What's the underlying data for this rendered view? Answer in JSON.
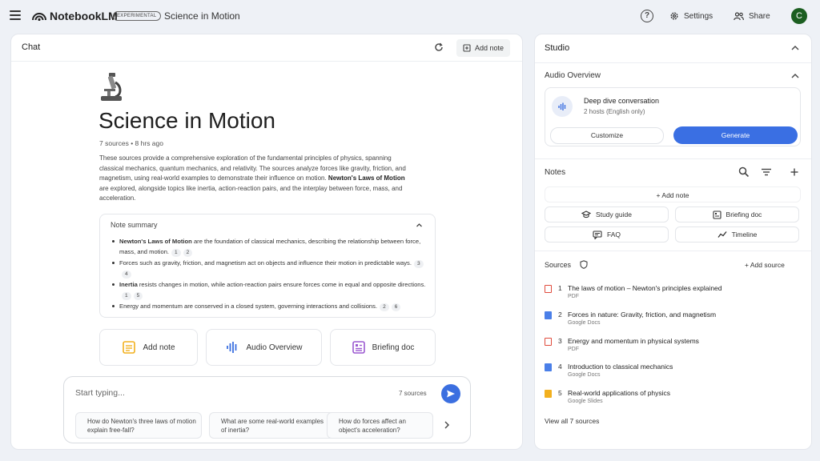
{
  "topbar": {
    "app_name": "NotebookLM",
    "badge": "EXPERIMENTAL",
    "notebook_title": "Science in Motion",
    "help_label": "?",
    "settings_label": "Settings",
    "share_label": "Share",
    "avatar_letter": "C"
  },
  "chat": {
    "title": "Chat",
    "add_note_label": "Add note",
    "heading": "Science in Motion",
    "meta": "7 sources • 8 hrs ago",
    "description_part1": "These sources provide a comprehensive exploration of the fundamental principles of physics, spanning classical mechanics, quantum mechanics, and relativity. The sources analyze forces like gravity, friction, and magnetism, using real-world examples to demonstrate their influence on motion. ",
    "description_bold": "Newton's Laws of Motion",
    "description_part2": " are explored, alongside topics like inertia, action-reaction pairs, and the interplay between force, mass, and acceleration.",
    "summary": {
      "title": "Note summary",
      "items": [
        {
          "bold": "Newton's Laws of Motion",
          "text": " are the foundation of classical mechanics, describing the relationship between force, mass, and motion.",
          "cites": [
            "1",
            "2"
          ]
        },
        {
          "bold": "",
          "text": "Forces such as gravity, friction, and magnetism act on objects and influence their motion in predictable ways.",
          "cites": [
            "3",
            "4"
          ]
        },
        {
          "bold": "Inertia",
          "text": " resists changes in motion, while action-reaction pairs ensure forces come in equal and opposite directions.",
          "cites": [
            "1",
            "5"
          ]
        },
        {
          "bold": "",
          "text": "Energy and momentum are conserved in a closed system, governing interactions and collisions.",
          "cites": [
            "2",
            "6"
          ]
        }
      ]
    },
    "actions": {
      "add_note": "Add note",
      "audio_overview": "Audio Overview",
      "briefing_doc": "Briefing doc"
    },
    "input": {
      "placeholder": "Start typing...",
      "source_count": "7 sources"
    },
    "suggestions": [
      "How do Newton's three laws of motion explain free-fall?",
      "What are some real-world examples of inertia?",
      "How do forces affect an object's acceleration?"
    ]
  },
  "studio": {
    "title": "Studio",
    "audio_overview": {
      "title": "Audio Overview",
      "name": "Deep dive conversation",
      "subtitle": "2 hosts (English only)",
      "customize": "Customize",
      "generate": "Generate"
    },
    "notes": {
      "title": "Notes",
      "add_note": "+ Add note",
      "buttons": {
        "study_guide": "Study guide",
        "briefing_doc": "Briefing doc",
        "faq": "FAQ",
        "timeline": "Timeline"
      }
    },
    "sources": {
      "title": "Sources",
      "add_source": "+ Add source",
      "items": [
        {
          "num": "1",
          "name": "The laws of motion – Newton's principles explained",
          "type": "PDF",
          "color": "#e04b3c"
        },
        {
          "num": "2",
          "name": "Forces in nature: Gravity, friction, and magnetism",
          "type": "Google Docs",
          "color": "#4a7fe8"
        },
        {
          "num": "3",
          "name": "Energy and momentum in physical systems",
          "type": "PDF",
          "color": "#e04b3c"
        },
        {
          "num": "4",
          "name": "Introduction to classical mechanics",
          "type": "Google Docs",
          "color": "#4a7fe8"
        },
        {
          "num": "5",
          "name": "Real-world applications of physics",
          "type": "Google Slides",
          "color": "#f2b01e"
        }
      ],
      "view_all": "View all 7 sources"
    }
  },
  "colors": {
    "accent": "#3a6fe3",
    "background": "#eef1f6",
    "avatar": "#1b5e20"
  }
}
